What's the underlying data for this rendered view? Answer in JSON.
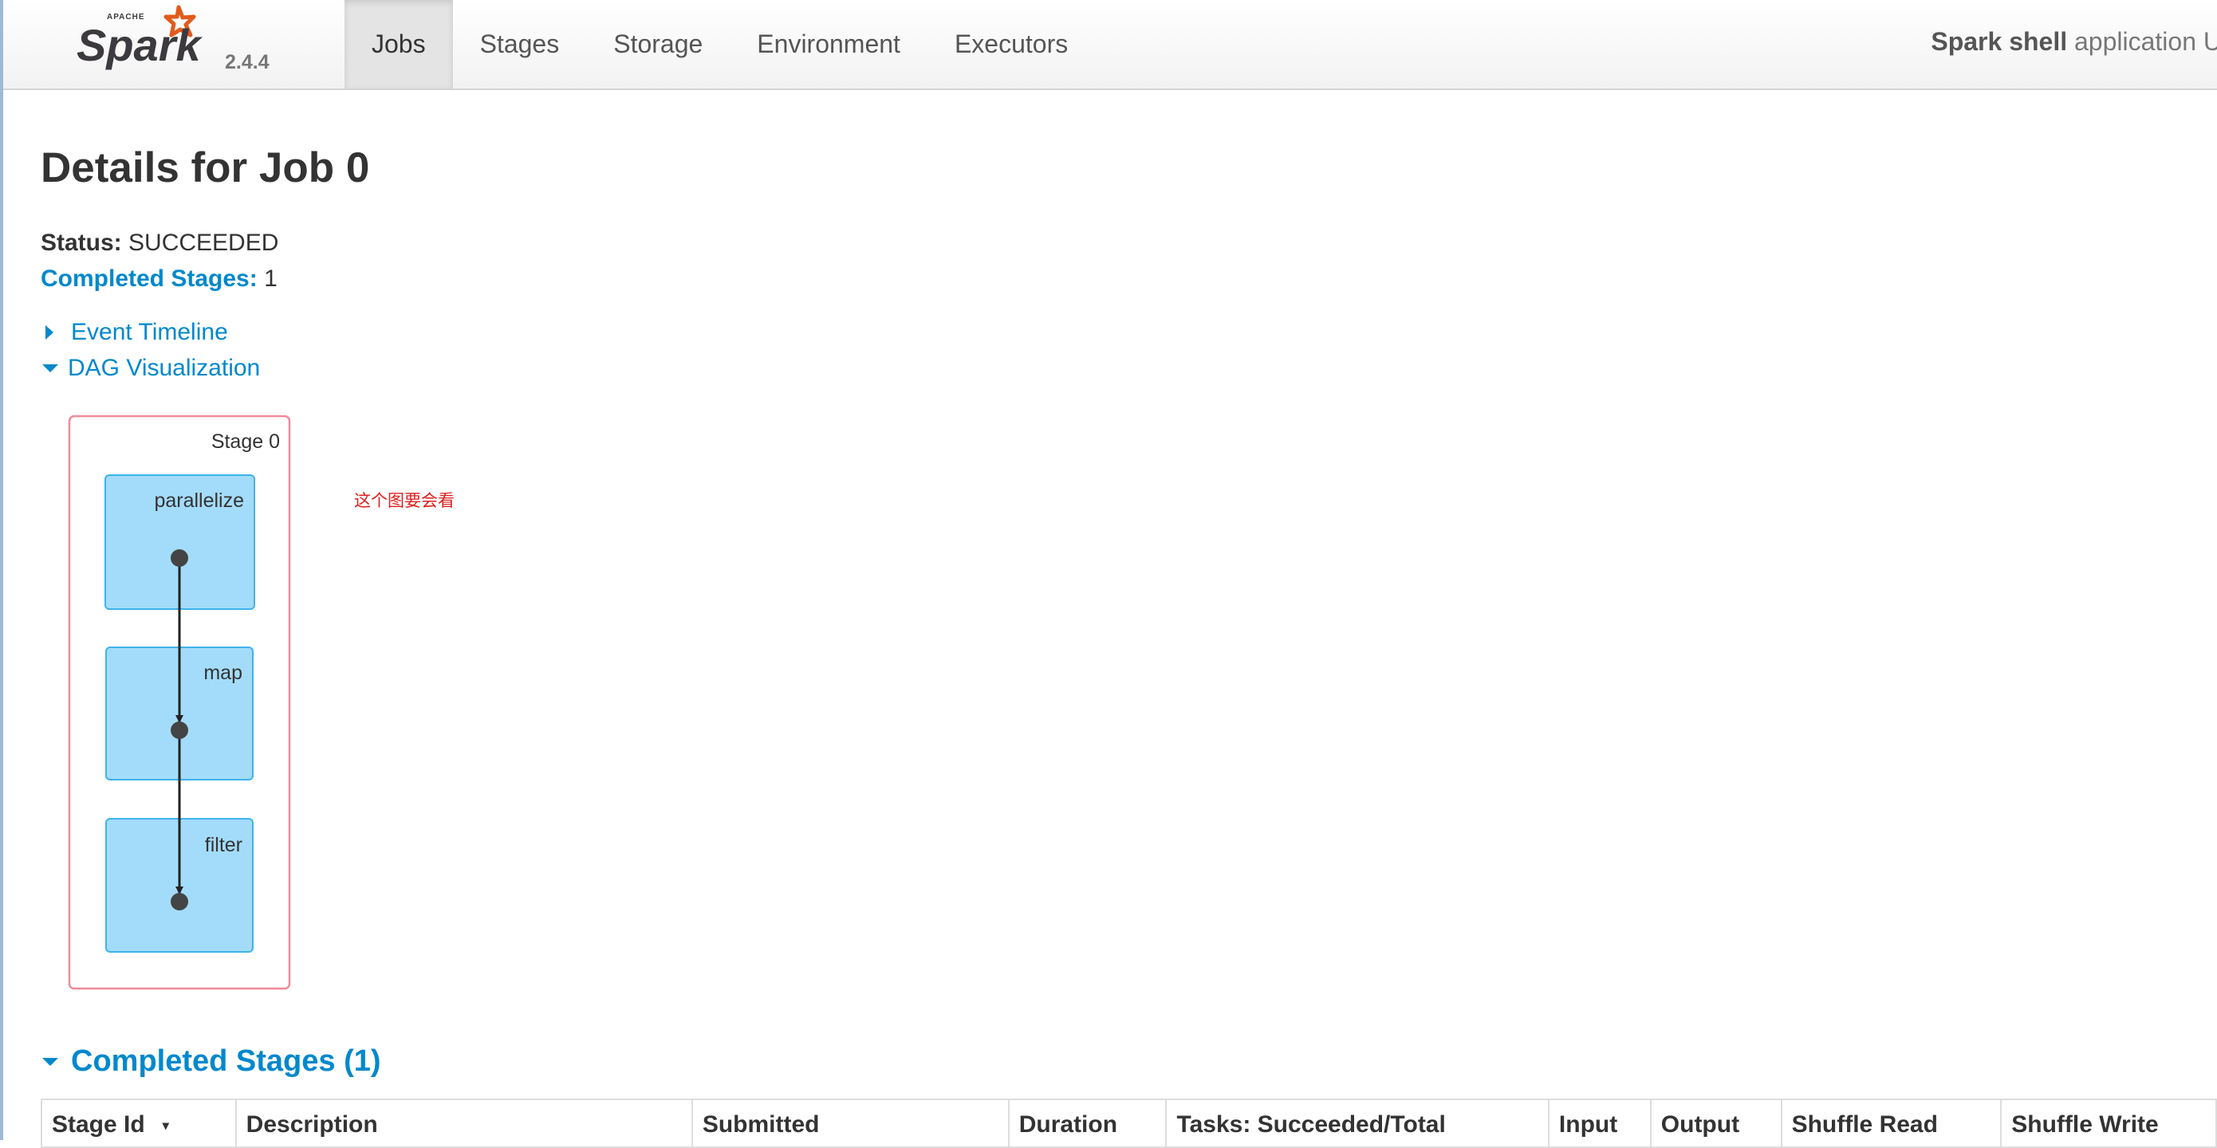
{
  "navbar": {
    "brand": {
      "logo_text": "Spark",
      "logo_small_text": "APACHE",
      "version": "2.4.4"
    },
    "tabs": [
      {
        "label": "Jobs",
        "active": true
      },
      {
        "label": "Stages",
        "active": false
      },
      {
        "label": "Storage",
        "active": false
      },
      {
        "label": "Environment",
        "active": false
      },
      {
        "label": "Executors",
        "active": false
      }
    ],
    "app_name_bold": "Spark shell",
    "app_name_rest": " application U"
  },
  "job": {
    "title": "Details for Job 0",
    "status_label": "Status:",
    "status_value": "SUCCEEDED",
    "completed_stages_label": "Completed Stages:",
    "completed_stages_value": "1"
  },
  "toggles": {
    "event_timeline": "Event Timeline",
    "dag_visualization": "DAG Visualization"
  },
  "dag": {
    "stage_label": "Stage 0",
    "operations": [
      "parallelize",
      "map",
      "filter"
    ]
  },
  "annotation": "这个图要会看",
  "completed_stages": {
    "title": "Completed Stages (1)",
    "columns": [
      "Stage Id",
      "Description",
      "Submitted",
      "Duration",
      "Tasks: Succeeded/Total",
      "Input",
      "Output",
      "Shuffle Read",
      "Shuffle Write"
    ],
    "sort_indicator": "▾"
  },
  "colors": {
    "link": "#0088cc",
    "stage_border": "#f08a9b",
    "op_fill": "#a3dcfa",
    "op_border": "#3eb3ea",
    "annotation": "#e02020"
  }
}
